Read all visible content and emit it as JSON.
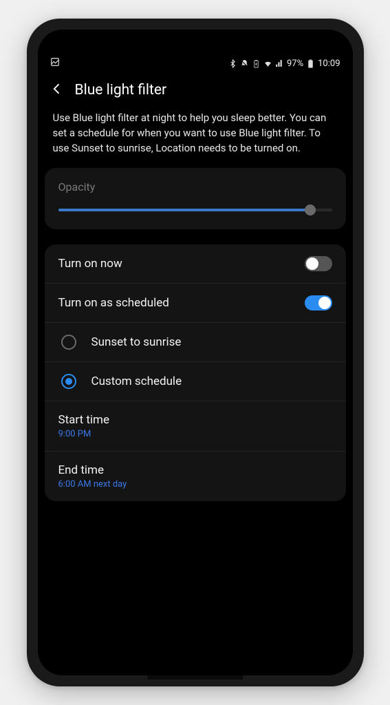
{
  "status": {
    "battery_pct": "97%",
    "time": "10:09"
  },
  "header": {
    "title": "Blue light filter"
  },
  "description": "Use Blue light filter at night to help you sleep better. You can set a schedule for when you want to use Blue light filter. To use Sunset to sunrise, Location needs to be turned on.",
  "opacity": {
    "label": "Opacity",
    "value_pct": 92
  },
  "toggles": {
    "turn_on_now": {
      "label": "Turn on now",
      "on": false
    },
    "turn_on_scheduled": {
      "label": "Turn on as scheduled",
      "on": true
    }
  },
  "schedule_options": {
    "sunset": {
      "label": "Sunset to sunrise",
      "selected": false
    },
    "custom": {
      "label": "Custom schedule",
      "selected": true
    }
  },
  "start_time": {
    "label": "Start time",
    "value": "9:00 PM"
  },
  "end_time": {
    "label": "End time",
    "value": "6:00 AM next day"
  }
}
